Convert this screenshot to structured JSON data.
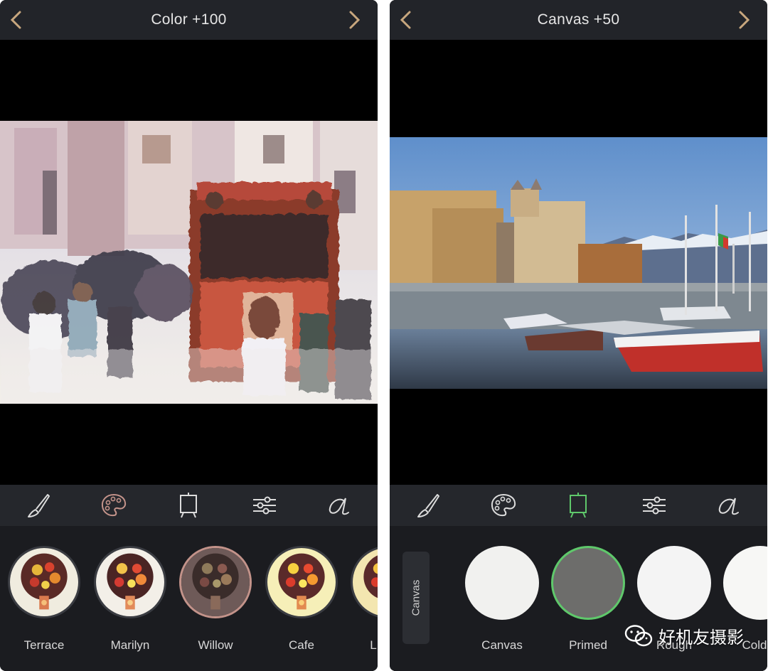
{
  "colors": {
    "header_bg": "#222429",
    "toolbar_bg": "#25272c",
    "tray_bg": "#1b1c20",
    "arrow_accent": "#c8a77e",
    "selected_palette": "#c3938a",
    "selected_canvas": "#5fc86b"
  },
  "left_screen": {
    "title": "Color +100",
    "toolbar": {
      "tools": [
        "brush-icon",
        "palette-icon",
        "canvas-easel-icon",
        "sliders-icon",
        "signature-a-icon"
      ],
      "active_tool": "palette-icon"
    },
    "presets": [
      {
        "label": "Terrace"
      },
      {
        "label": "Marilyn"
      },
      {
        "label": "Willow",
        "selected": true
      },
      {
        "label": "Cafe"
      },
      {
        "label": "L"
      }
    ]
  },
  "right_screen": {
    "title": "Canvas +50",
    "toolbar": {
      "tools": [
        "brush-icon",
        "palette-icon",
        "canvas-easel-icon",
        "sliders-icon",
        "signature-a-icon"
      ],
      "active_tool": "canvas-easel-icon"
    },
    "tab_label": "Canvas",
    "textures": [
      {
        "label": "Canvas"
      },
      {
        "label": "Primed",
        "selected": true
      },
      {
        "label": "Rough"
      },
      {
        "label": "Cold P"
      }
    ]
  },
  "watermark": {
    "text": "好机友摄影",
    "icon": "wechat-icon"
  }
}
